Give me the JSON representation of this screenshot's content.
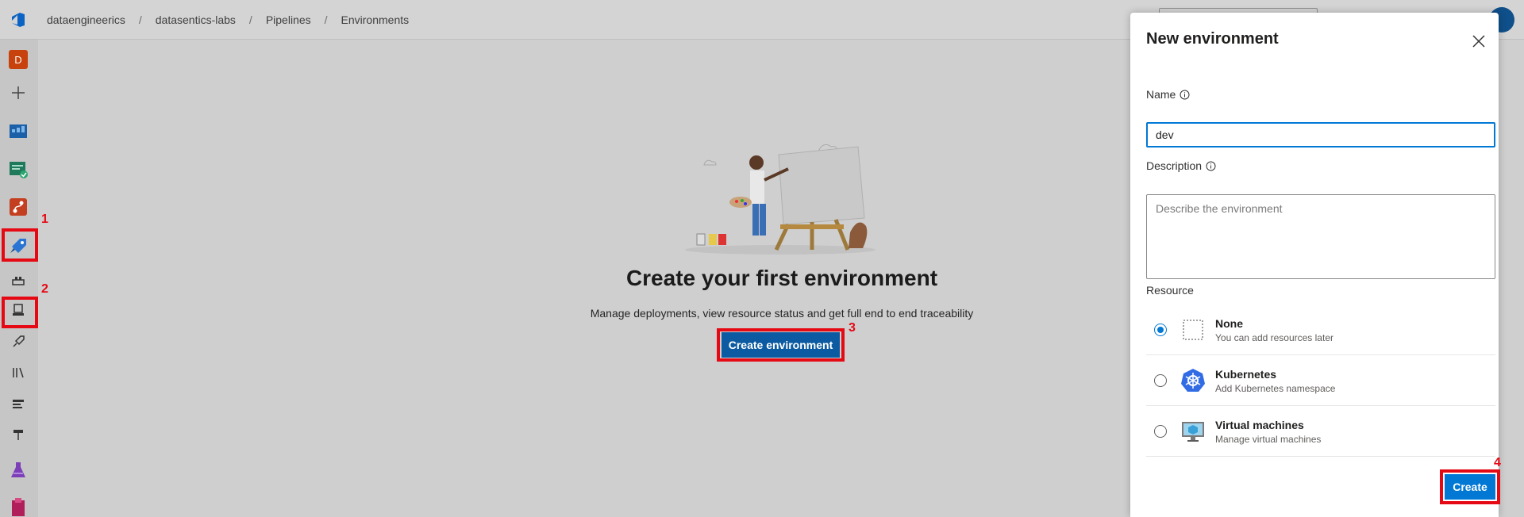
{
  "breadcrumb": {
    "items": [
      "dataengineerics",
      "datasentics-labs",
      "Pipelines",
      "Environments"
    ],
    "separator": "/"
  },
  "rail": {
    "avatar_letter": "D",
    "icons": [
      "plus-icon",
      "boards-icon",
      "test-plans-icon",
      "repos-icon",
      "pipelines-icon",
      "deployment-groups-icon",
      "environments-icon",
      "releases-icon",
      "library-icon",
      "task-groups-icon",
      "deployment-icon",
      "test-icon",
      "artifacts-icon"
    ]
  },
  "annotations": {
    "one": "1",
    "two": "2",
    "three": "3",
    "four": "4"
  },
  "empty_state": {
    "title": "Create your first environment",
    "subtitle": "Manage deployments, view resource status and get full end to end traceability",
    "button_label": "Create environment"
  },
  "panel": {
    "title": "New environment",
    "name_label": "Name",
    "name_value": "dev",
    "description_label": "Description",
    "description_placeholder": "Describe the environment",
    "resource_label": "Resource",
    "resources": [
      {
        "name": "None",
        "desc": "You can add resources later",
        "selected": true
      },
      {
        "name": "Kubernetes",
        "desc": "Add Kubernetes namespace",
        "selected": false
      },
      {
        "name": "Virtual machines",
        "desc": "Manage virtual machines",
        "selected": false
      }
    ],
    "create_label": "Create"
  },
  "colors": {
    "accent": "#0078d4",
    "highlight": "#e50914",
    "dark_button": "#0c5ba2"
  }
}
